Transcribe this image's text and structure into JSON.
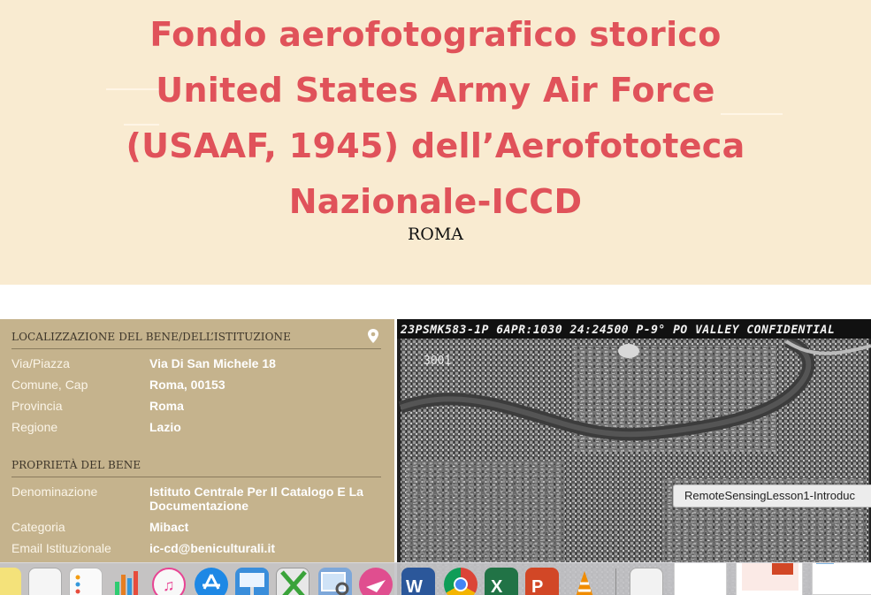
{
  "header": {
    "title_lines": [
      "Fondo aerofotografico storico",
      "United States Army Air Force",
      "(USAAF, 1945) dell’Aerofototeca",
      "Nazionale-ICCD"
    ],
    "subtitle": "ROMA"
  },
  "location": {
    "heading": "LOCALIZZAZIONE DEL BENE/DELL’ISTITUZIONE",
    "icon": "map-pin-icon",
    "rows": [
      {
        "key": "Via/Piazza",
        "value": "Via Di San Michele 18"
      },
      {
        "key": "Comune, Cap",
        "value": "Roma, 00153"
      },
      {
        "key": "Provincia",
        "value": "Roma"
      },
      {
        "key": "Regione",
        "value": "Lazio"
      }
    ]
  },
  "property": {
    "heading": "PROPRIETÀ DEL BENE",
    "rows": [
      {
        "key": "Denominazione",
        "value": "Istituto Centrale Per Il Catalogo E La Documentazione"
      },
      {
        "key": "Categoria",
        "value": "Mibact"
      },
      {
        "key": "Email Istituzionale",
        "value": "ic-cd@beniculturali.it"
      }
    ]
  },
  "photo": {
    "banner": "23PSMK583-1P 6APR:1030  24:24500 P-9° PO VALLEY CONFIDENTIAL",
    "number": "3001"
  },
  "tooltip": "RemoteSensingLesson1-Introduc",
  "dock": {
    "apps": [
      "notes-icon",
      "textedit-icon",
      "reminders-icon",
      "numbers-icon",
      "itunes-icon",
      "app-store-icon",
      "keynote-icon",
      "xquartz-icon",
      "preview-icon",
      "skitch-icon",
      "word-icon",
      "chrome-icon",
      "excel-icon",
      "powerpoint-icon",
      "vlc-icon",
      "document-icon"
    ]
  },
  "colors": {
    "title": "#e0525a",
    "header_bg": "#f9ebd1",
    "panel_bg": "#c5b38d"
  }
}
